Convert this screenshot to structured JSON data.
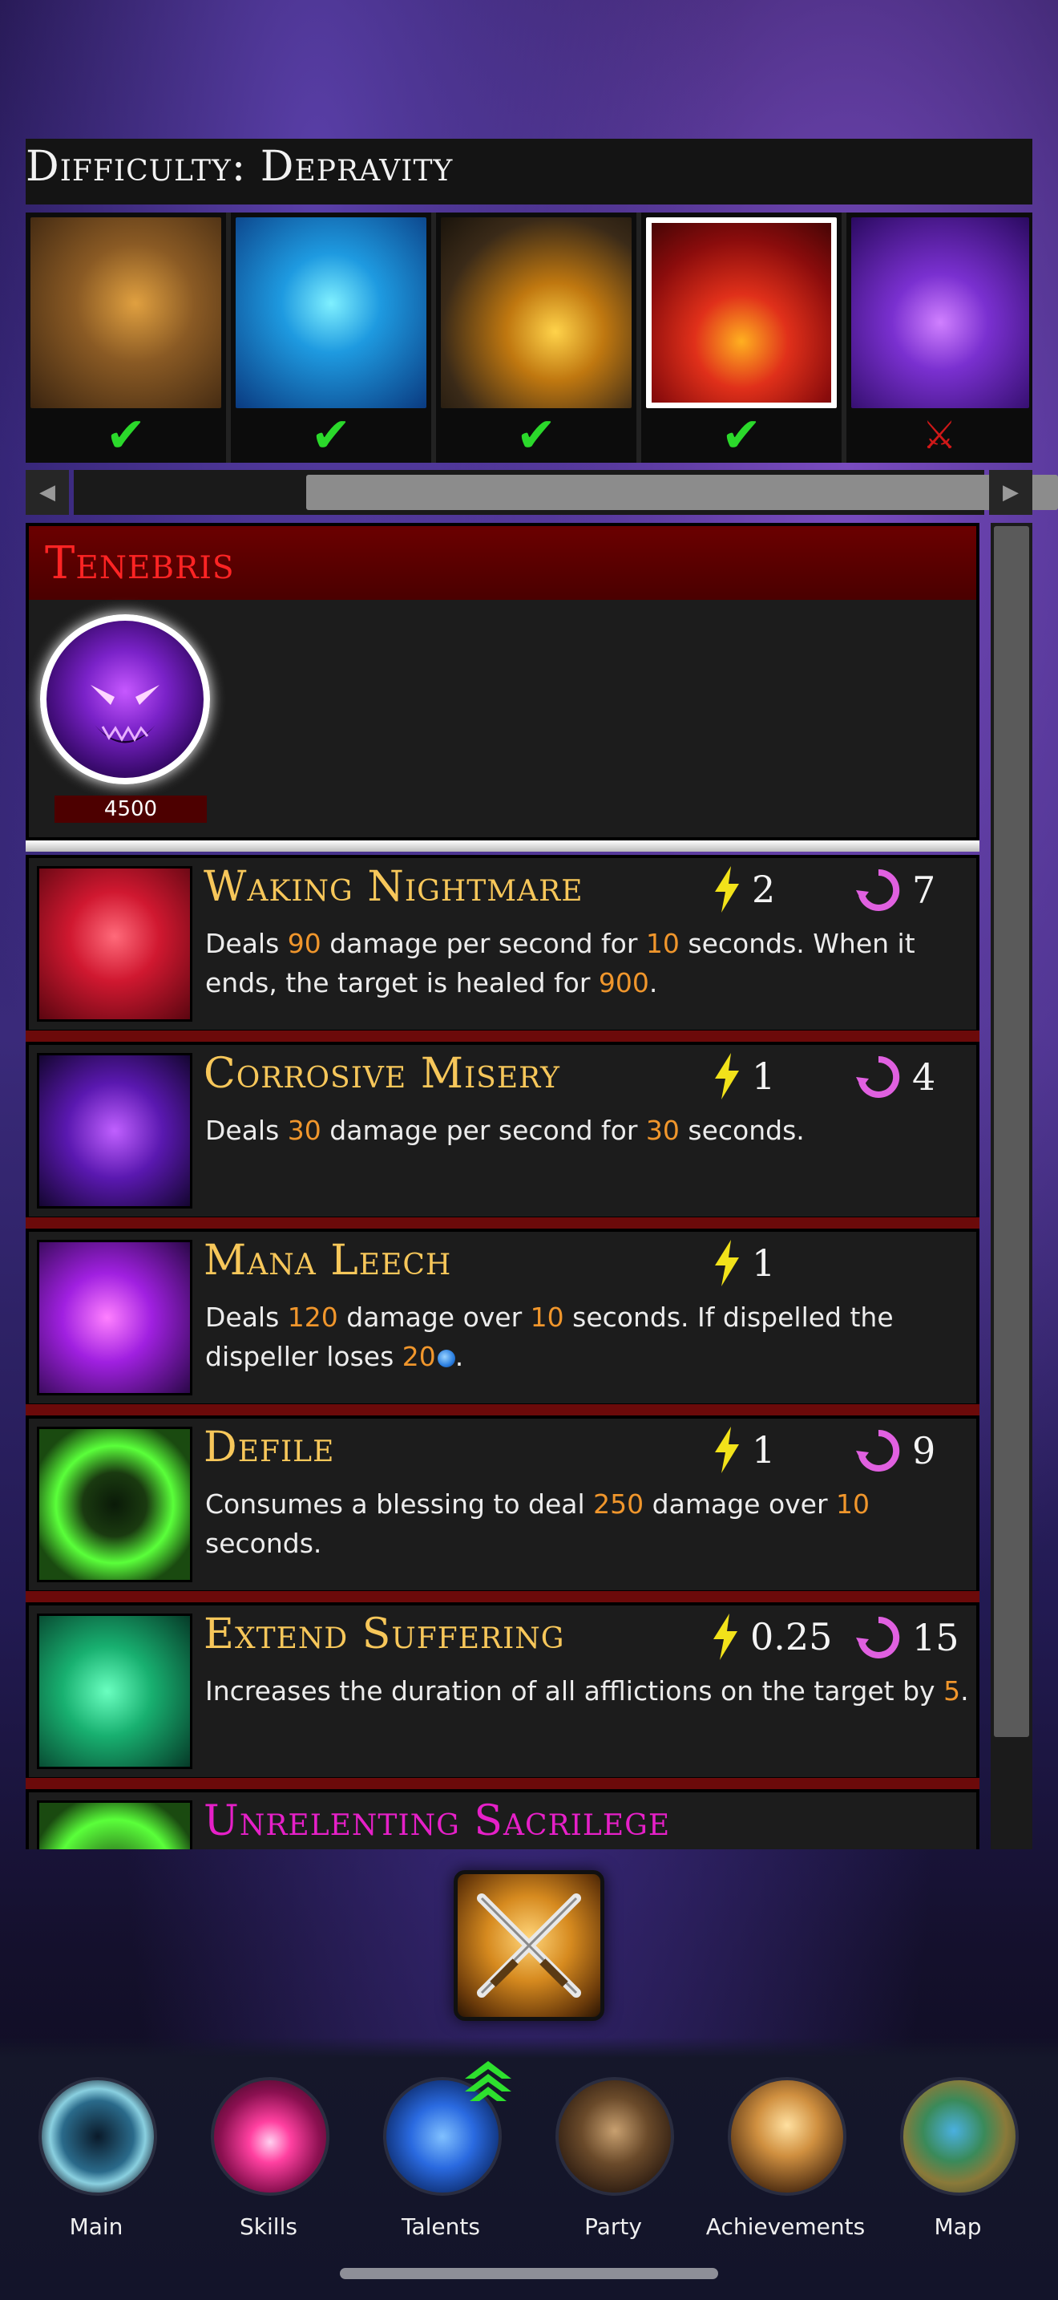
{
  "difficulty": {
    "title": "Difficulty: Depravity"
  },
  "bosses": [
    {
      "name": "dragon-gold",
      "status": "defeated",
      "mark": "✔"
    },
    {
      "name": "dragon-blue",
      "status": "defeated",
      "mark": "✔"
    },
    {
      "name": "dragon-amber",
      "status": "defeated",
      "mark": "✔"
    },
    {
      "name": "dragon-red",
      "status": "defeated",
      "mark": "✔",
      "selected": true
    },
    {
      "name": "dragon-purple",
      "status": "locked",
      "mark": "⚔"
    }
  ],
  "scroll": {
    "left_arrow": "◀",
    "right_arrow": "▶"
  },
  "boss": {
    "name": "Tenebris",
    "hp": "4500"
  },
  "abilities": [
    {
      "name": "Waking Nightmare",
      "energy": "2",
      "cooldown": "7",
      "desc": [
        {
          "t": "Deals "
        },
        {
          "n": "90"
        },
        {
          "t": " damage per second for "
        },
        {
          "n": "10"
        },
        {
          "t": " seconds. When it ends, the target is healed for "
        },
        {
          "n": "900"
        },
        {
          "t": "."
        }
      ]
    },
    {
      "name": "Corrosive Misery",
      "energy": "1",
      "cooldown": "4",
      "desc": [
        {
          "t": "Deals "
        },
        {
          "n": "30"
        },
        {
          "t": " damage per second for "
        },
        {
          "n": "30"
        },
        {
          "t": " seconds."
        }
      ]
    },
    {
      "name": "Mana Leech",
      "energy": "1",
      "cooldown": "",
      "desc": [
        {
          "t": "Deals "
        },
        {
          "n": "120"
        },
        {
          "t": " damage over "
        },
        {
          "n": "10"
        },
        {
          "t": " seconds. If dispelled the dispeller loses "
        },
        {
          "n": "20"
        },
        {
          "mana": true
        },
        {
          "t": "."
        }
      ]
    },
    {
      "name": "Defile",
      "energy": "1",
      "cooldown": "9",
      "desc": [
        {
          "t": "Consumes a blessing to deal "
        },
        {
          "n": "250"
        },
        {
          "t": " damage over "
        },
        {
          "n": "10"
        },
        {
          "t": " seconds."
        }
      ]
    },
    {
      "name": "Extend Suffering",
      "energy": "0.25",
      "cooldown": "15",
      "desc": [
        {
          "t": "Increases the duration of all afflictions on the target by "
        },
        {
          "n": "5"
        },
        {
          "t": "."
        }
      ]
    },
    {
      "name": "Unrelenting Sacrilege",
      "energy": "",
      "cooldown": "",
      "name_color": "#e620c8",
      "desc": []
    }
  ],
  "fight_button": {
    "icon": "crossed-swords-icon"
  },
  "nav": [
    {
      "id": "main",
      "label": "Main"
    },
    {
      "id": "skills",
      "label": "Skills"
    },
    {
      "id": "talents",
      "label": "Talents"
    },
    {
      "id": "party",
      "label": "Party"
    },
    {
      "id": "achievements",
      "label": "Achievements"
    },
    {
      "id": "map",
      "label": "Map"
    }
  ],
  "colors": {
    "accent_gold": "#f7c75a",
    "number_orange": "#f0962c",
    "boss_red": "#ff2424",
    "check_green": "#2bd92b",
    "locked_red": "#d01818"
  }
}
